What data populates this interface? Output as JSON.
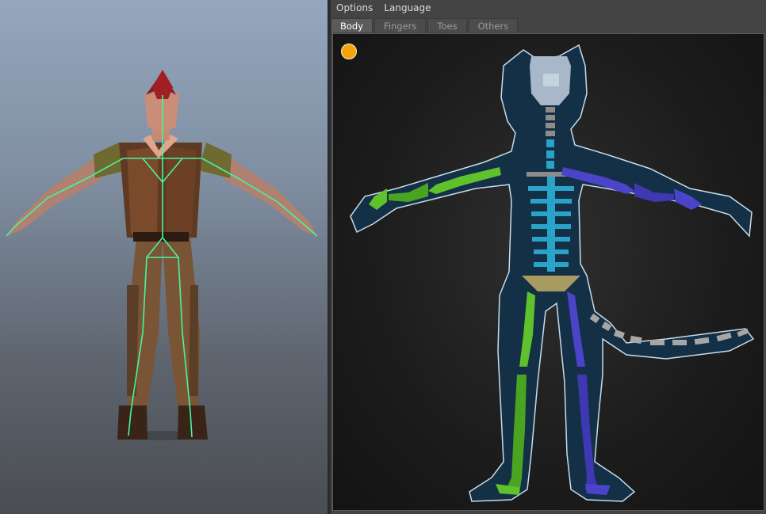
{
  "menu": {
    "options": "Options",
    "language": "Language"
  },
  "tabs": [
    "Body",
    "Fingers",
    "Toes",
    "Others"
  ],
  "active_tab": "Body",
  "colors": {
    "left_side": "#5fc22d",
    "right_side": "#4b44c9",
    "center": "#2aa3c9",
    "head": "#a8b8c9",
    "hips": "#a89b62",
    "tail": "#a6a6a6",
    "indicator": "#f5a50b",
    "skeleton_overlay": "#46f5a0"
  },
  "indicator_icon": "status-dot-icon"
}
